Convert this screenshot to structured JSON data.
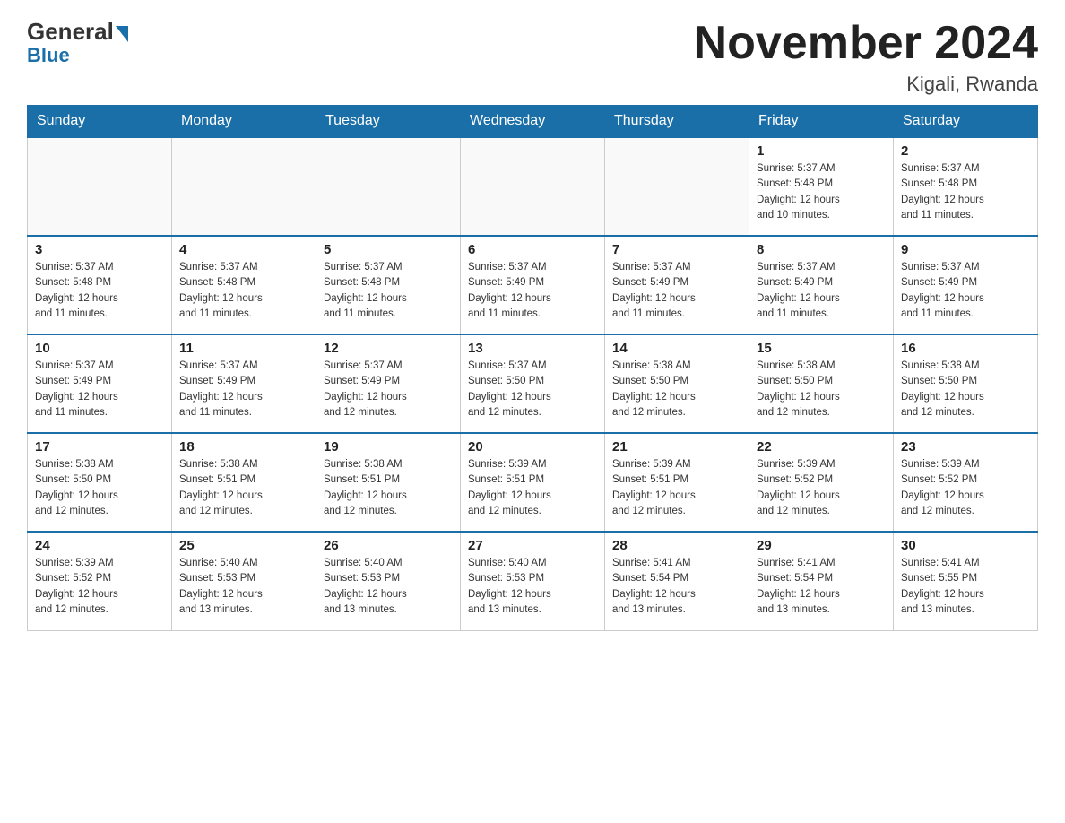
{
  "logo": {
    "general": "General",
    "blue": "Blue"
  },
  "title": "November 2024",
  "location": "Kigali, Rwanda",
  "weekdays": [
    "Sunday",
    "Monday",
    "Tuesday",
    "Wednesday",
    "Thursday",
    "Friday",
    "Saturday"
  ],
  "weeks": [
    [
      {
        "day": "",
        "info": ""
      },
      {
        "day": "",
        "info": ""
      },
      {
        "day": "",
        "info": ""
      },
      {
        "day": "",
        "info": ""
      },
      {
        "day": "",
        "info": ""
      },
      {
        "day": "1",
        "info": "Sunrise: 5:37 AM\nSunset: 5:48 PM\nDaylight: 12 hours\nand 10 minutes."
      },
      {
        "day": "2",
        "info": "Sunrise: 5:37 AM\nSunset: 5:48 PM\nDaylight: 12 hours\nand 11 minutes."
      }
    ],
    [
      {
        "day": "3",
        "info": "Sunrise: 5:37 AM\nSunset: 5:48 PM\nDaylight: 12 hours\nand 11 minutes."
      },
      {
        "day": "4",
        "info": "Sunrise: 5:37 AM\nSunset: 5:48 PM\nDaylight: 12 hours\nand 11 minutes."
      },
      {
        "day": "5",
        "info": "Sunrise: 5:37 AM\nSunset: 5:48 PM\nDaylight: 12 hours\nand 11 minutes."
      },
      {
        "day": "6",
        "info": "Sunrise: 5:37 AM\nSunset: 5:49 PM\nDaylight: 12 hours\nand 11 minutes."
      },
      {
        "day": "7",
        "info": "Sunrise: 5:37 AM\nSunset: 5:49 PM\nDaylight: 12 hours\nand 11 minutes."
      },
      {
        "day": "8",
        "info": "Sunrise: 5:37 AM\nSunset: 5:49 PM\nDaylight: 12 hours\nand 11 minutes."
      },
      {
        "day": "9",
        "info": "Sunrise: 5:37 AM\nSunset: 5:49 PM\nDaylight: 12 hours\nand 11 minutes."
      }
    ],
    [
      {
        "day": "10",
        "info": "Sunrise: 5:37 AM\nSunset: 5:49 PM\nDaylight: 12 hours\nand 11 minutes."
      },
      {
        "day": "11",
        "info": "Sunrise: 5:37 AM\nSunset: 5:49 PM\nDaylight: 12 hours\nand 11 minutes."
      },
      {
        "day": "12",
        "info": "Sunrise: 5:37 AM\nSunset: 5:49 PM\nDaylight: 12 hours\nand 12 minutes."
      },
      {
        "day": "13",
        "info": "Sunrise: 5:37 AM\nSunset: 5:50 PM\nDaylight: 12 hours\nand 12 minutes."
      },
      {
        "day": "14",
        "info": "Sunrise: 5:38 AM\nSunset: 5:50 PM\nDaylight: 12 hours\nand 12 minutes."
      },
      {
        "day": "15",
        "info": "Sunrise: 5:38 AM\nSunset: 5:50 PM\nDaylight: 12 hours\nand 12 minutes."
      },
      {
        "day": "16",
        "info": "Sunrise: 5:38 AM\nSunset: 5:50 PM\nDaylight: 12 hours\nand 12 minutes."
      }
    ],
    [
      {
        "day": "17",
        "info": "Sunrise: 5:38 AM\nSunset: 5:50 PM\nDaylight: 12 hours\nand 12 minutes."
      },
      {
        "day": "18",
        "info": "Sunrise: 5:38 AM\nSunset: 5:51 PM\nDaylight: 12 hours\nand 12 minutes."
      },
      {
        "day": "19",
        "info": "Sunrise: 5:38 AM\nSunset: 5:51 PM\nDaylight: 12 hours\nand 12 minutes."
      },
      {
        "day": "20",
        "info": "Sunrise: 5:39 AM\nSunset: 5:51 PM\nDaylight: 12 hours\nand 12 minutes."
      },
      {
        "day": "21",
        "info": "Sunrise: 5:39 AM\nSunset: 5:51 PM\nDaylight: 12 hours\nand 12 minutes."
      },
      {
        "day": "22",
        "info": "Sunrise: 5:39 AM\nSunset: 5:52 PM\nDaylight: 12 hours\nand 12 minutes."
      },
      {
        "day": "23",
        "info": "Sunrise: 5:39 AM\nSunset: 5:52 PM\nDaylight: 12 hours\nand 12 minutes."
      }
    ],
    [
      {
        "day": "24",
        "info": "Sunrise: 5:39 AM\nSunset: 5:52 PM\nDaylight: 12 hours\nand 12 minutes."
      },
      {
        "day": "25",
        "info": "Sunrise: 5:40 AM\nSunset: 5:53 PM\nDaylight: 12 hours\nand 13 minutes."
      },
      {
        "day": "26",
        "info": "Sunrise: 5:40 AM\nSunset: 5:53 PM\nDaylight: 12 hours\nand 13 minutes."
      },
      {
        "day": "27",
        "info": "Sunrise: 5:40 AM\nSunset: 5:53 PM\nDaylight: 12 hours\nand 13 minutes."
      },
      {
        "day": "28",
        "info": "Sunrise: 5:41 AM\nSunset: 5:54 PM\nDaylight: 12 hours\nand 13 minutes."
      },
      {
        "day": "29",
        "info": "Sunrise: 5:41 AM\nSunset: 5:54 PM\nDaylight: 12 hours\nand 13 minutes."
      },
      {
        "day": "30",
        "info": "Sunrise: 5:41 AM\nSunset: 5:55 PM\nDaylight: 12 hours\nand 13 minutes."
      }
    ]
  ]
}
